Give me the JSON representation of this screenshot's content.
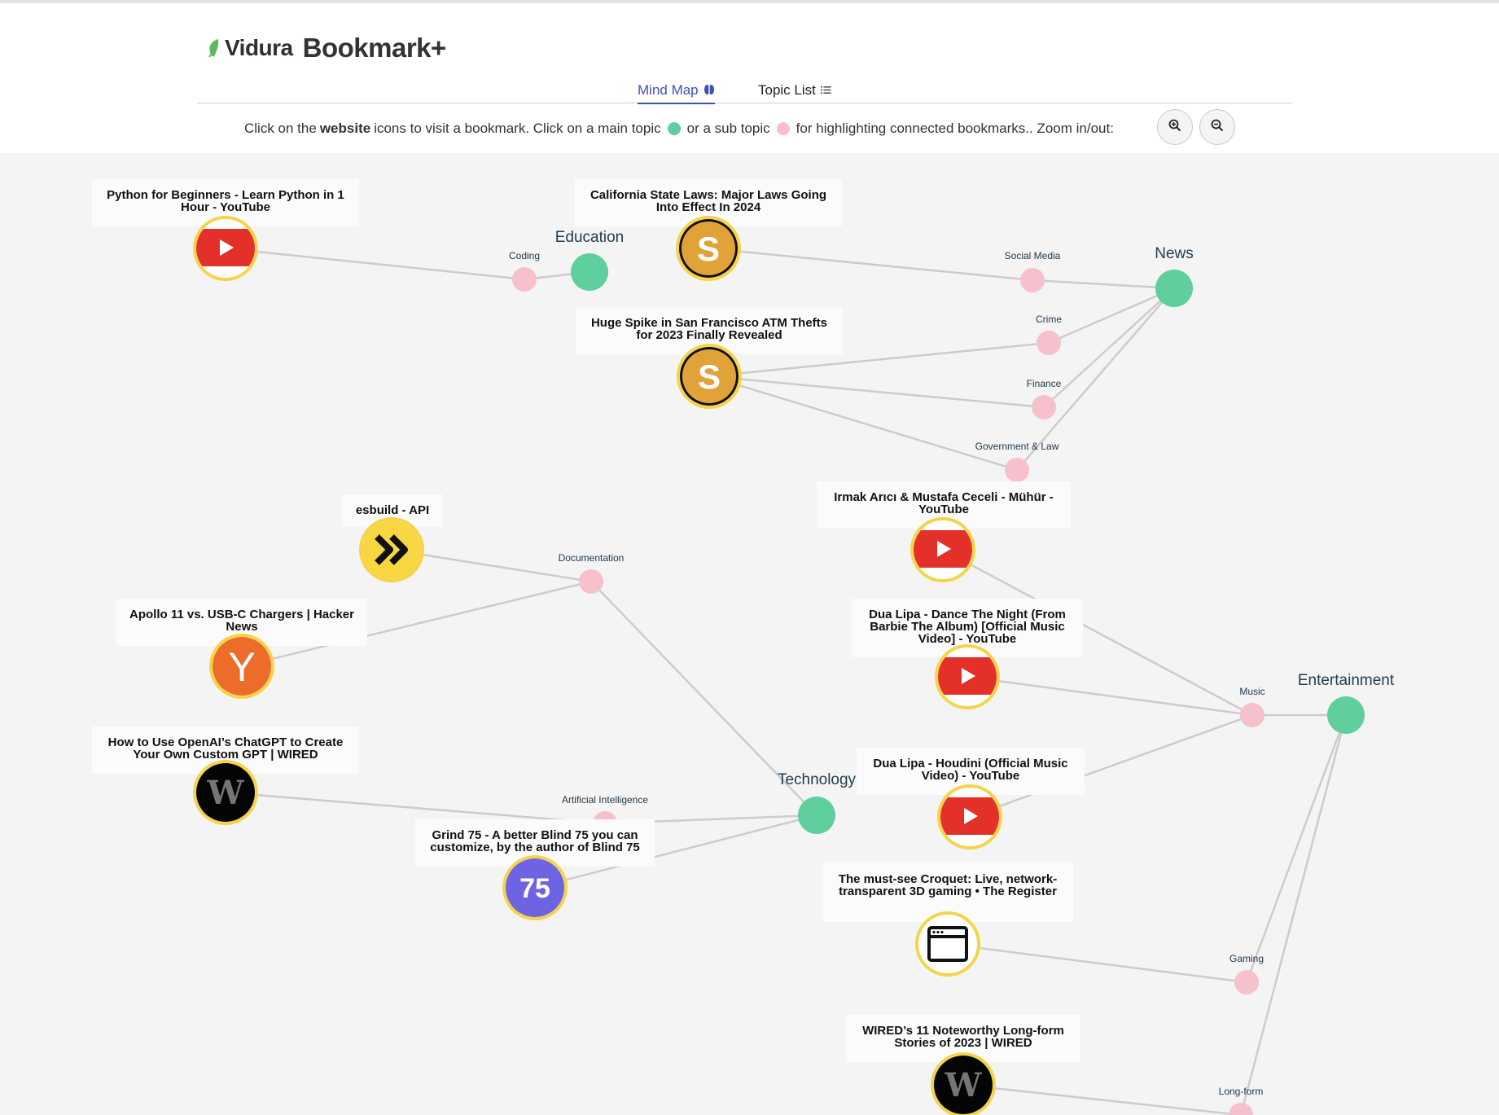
{
  "brand": {
    "name": "Vidura",
    "product": "Bookmark+"
  },
  "tabs": [
    {
      "label": "Mind Map",
      "icon": "brain-icon",
      "active": true
    },
    {
      "label": "Topic List",
      "icon": "list-icon",
      "active": false
    }
  ],
  "instructions": {
    "part1": "Click on the",
    "bold": "website",
    "part2": "icons to visit a bookmark. Click on a main topic",
    "part3": "or a sub topic",
    "part4": "for highlighting connected bookmarks.. Zoom in/out:"
  },
  "zoom": {
    "in_icon": "zoom-in-icon",
    "out_icon": "zoom-out-icon"
  },
  "colors": {
    "main_topic": "#5fcf9d",
    "sub_topic": "#f6c1cc",
    "bookmark_ring": "#f5d44a",
    "tab_active": "#3f51b5",
    "canvas_bg": "#f4f4f4",
    "link": "#cccccc",
    "brand_leaf": "#5cb85c"
  },
  "main_topics": [
    {
      "id": "education",
      "label": "Education"
    },
    {
      "id": "news",
      "label": "News"
    },
    {
      "id": "technology",
      "label": "Technology"
    },
    {
      "id": "entertainment",
      "label": "Entertainment"
    }
  ],
  "sub_topics": [
    {
      "id": "coding",
      "label": "Coding"
    },
    {
      "id": "social-media",
      "label": "Social Media"
    },
    {
      "id": "crime",
      "label": "Crime"
    },
    {
      "id": "finance",
      "label": "Finance"
    },
    {
      "id": "gov-law",
      "label": "Government & Law"
    },
    {
      "id": "documentation",
      "label": "Documentation"
    },
    {
      "id": "ai",
      "label": "Artificial Intelligence"
    },
    {
      "id": "music",
      "label": "Music"
    },
    {
      "id": "gaming",
      "label": "Gaming"
    },
    {
      "id": "long-form",
      "label": "Long-form"
    }
  ],
  "bookmarks": [
    {
      "id": "python",
      "title": "Python for Beginners - Learn Python in 1 Hour - YouTube",
      "icon": "youtube-icon"
    },
    {
      "id": "california",
      "title": "California State Laws: Major Laws Going Into Effect In 2024",
      "icon": "s-logo-icon"
    },
    {
      "id": "atm",
      "title": "Huge Spike in San Francisco ATM Thefts for 2023 Finally Revealed",
      "icon": "s-logo-icon"
    },
    {
      "id": "esbuild",
      "title": "esbuild - API",
      "icon": "esbuild-icon"
    },
    {
      "id": "apollo",
      "title": "Apollo 11 vs. USB-C Chargers | Hacker News",
      "icon": "hacker-news-icon"
    },
    {
      "id": "openai",
      "title": "How to Use OpenAI’s ChatGPT to Create Your Own Custom GPT | WIRED",
      "icon": "wired-icon"
    },
    {
      "id": "grind",
      "title": "Grind 75 - A better Blind 75 you can customize, by the author of Blind 75",
      "icon": "grind75-icon",
      "icon_text": "75"
    },
    {
      "id": "irmak",
      "title": "Irmak Arıcı & Mustafa Ceceli - Mühür - YouTube",
      "icon": "youtube-icon"
    },
    {
      "id": "dance",
      "title": "Dua Lipa - Dance The Night (From Barbie The Album) [Official Music Video] - YouTube",
      "icon": "youtube-icon"
    },
    {
      "id": "houdini",
      "title": "Dua Lipa - Houdini (Official Music Video) - YouTube",
      "icon": "youtube-icon"
    },
    {
      "id": "croquet",
      "title": "The must-see Croquet: Live, network-transparent 3D gaming • The Register",
      "icon": "browser-window-icon"
    },
    {
      "id": "wired11",
      "title": "WIRED’s 11 Noteworthy Long-form Stories of 2023 | WIRED",
      "icon": "wired-icon"
    }
  ],
  "links": [
    [
      "python",
      "coding"
    ],
    [
      "coding",
      "education"
    ],
    [
      "california",
      "social-media"
    ],
    [
      "social-media",
      "news"
    ],
    [
      "atm",
      "crime"
    ],
    [
      "atm",
      "finance"
    ],
    [
      "atm",
      "gov-law"
    ],
    [
      "crime",
      "news"
    ],
    [
      "finance",
      "news"
    ],
    [
      "gov-law",
      "news"
    ],
    [
      "esbuild",
      "documentation"
    ],
    [
      "apollo",
      "documentation"
    ],
    [
      "documentation",
      "technology"
    ],
    [
      "openai",
      "ai"
    ],
    [
      "ai",
      "technology"
    ],
    [
      "grind",
      "technology"
    ],
    [
      "irmak",
      "music"
    ],
    [
      "dance",
      "music"
    ],
    [
      "houdini",
      "music"
    ],
    [
      "music",
      "entertainment"
    ],
    [
      "croquet",
      "gaming"
    ],
    [
      "gaming",
      "entertainment"
    ],
    [
      "wired11",
      "long-form"
    ],
    [
      "long-form",
      "entertainment"
    ]
  ]
}
